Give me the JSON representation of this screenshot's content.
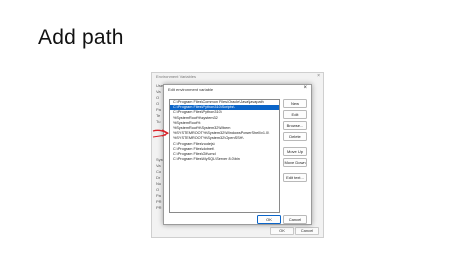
{
  "slide": {
    "title": "Add path"
  },
  "background_dialog": {
    "title": "Environment Variables",
    "close_glyph": "×",
    "fragments": [
      "Use",
      "Va",
      "O",
      "O",
      "Pa",
      "Te",
      "Tu",
      "Syst",
      "Va",
      "Co",
      "Dr",
      "Nu",
      "O",
      "Pa",
      "PR",
      "PR"
    ],
    "buttons": {
      "ok": "OK",
      "cancel": "Cancel"
    }
  },
  "edit_dialog": {
    "title": "Edit environment variable",
    "close_glyph": "×",
    "path_entries": [
      "C:\\Program Files\\Common Files\\Oracle\\Java\\javapath",
      "C:\\Program Files\\Python310\\Scripts\\",
      "C:\\Program Files\\Python310\\",
      "%SystemRoot%\\system32",
      "%SystemRoot%",
      "%SystemRoot%\\System32\\Wbem",
      "%SYSTEMROOT%\\System32\\WindowsPowerShell\\v1.0\\",
      "%SYSTEMROOT%\\System32\\OpenSSH\\",
      "C:\\Program Files\\nodejs\\",
      "C:\\Program Files\\dotnet\\",
      "C:\\Program Files\\Git\\cmd",
      "C:\\Program Files\\MySQL\\Server 8.0\\bin"
    ],
    "selected_index": 1,
    "side_buttons": {
      "new": "New",
      "edit": "Edit",
      "browse": "Browse...",
      "delete": "Delete",
      "move_up": "Move Up",
      "move_down": "Move Down",
      "edit_text": "Edit text..."
    },
    "bottom_buttons": {
      "ok": "OK",
      "cancel": "Cancel"
    }
  },
  "colors": {
    "selection": "#0a64c8",
    "annotation_arrow": "#d8232a"
  },
  "icons": {
    "pointer": "red-arrow-icon"
  }
}
